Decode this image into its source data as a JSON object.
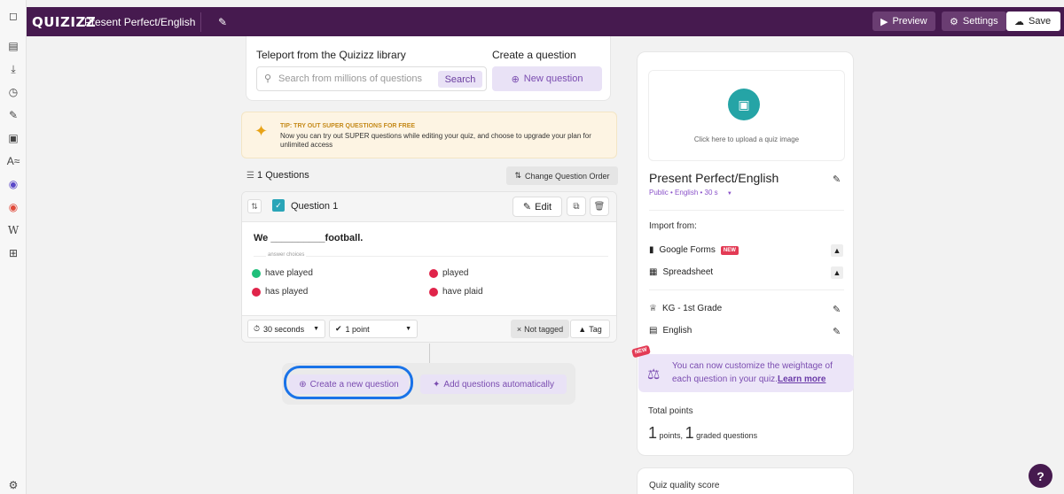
{
  "topbar": {
    "logo": "QUIZIZZ",
    "quiz_title": "Present Perfect/English",
    "preview_label": "Preview",
    "settings_label": "Settings",
    "save_label": "Save"
  },
  "teleport": {
    "heading": "Teleport from the Quizizz library",
    "search_placeholder": "Search from millions of questions",
    "search_button": "Search",
    "create_heading": "Create a question",
    "new_question_button": "New question"
  },
  "tip": {
    "title": "TIP: TRY OUT SUPER QUESTIONS FOR FREE",
    "body": "Now you can try out SUPER questions while editing your quiz, and choose to upgrade your plan for unlimited access"
  },
  "questions": {
    "count_label": "1 Questions",
    "change_order_label": "Change Question Order"
  },
  "question_card": {
    "label": "Question 1",
    "edit_label": "Edit",
    "text": "We __________football.",
    "answer_choices_label": "answer choices",
    "choices": [
      {
        "text": "have played",
        "correct": true
      },
      {
        "text": "played",
        "correct": false
      },
      {
        "text": "has played",
        "correct": false
      },
      {
        "text": "have plaid",
        "correct": false
      }
    ],
    "time_value": "30 seconds",
    "points_value": "1 point",
    "not_tagged_label": "Not tagged",
    "tag_label": "Tag"
  },
  "bottom_actions": {
    "create_new_label": "Create a new question",
    "add_auto_label": "Add questions automatically"
  },
  "right_panel": {
    "upload_text": "Click here to upload a quiz image",
    "title": "Present Perfect/English",
    "meta": "Public • English • 30 s",
    "import_from": "Import from:",
    "google_forms": "Google Forms",
    "new_badge": "NEW",
    "spreadsheet": "Spreadsheet",
    "grade": "KG - 1st Grade",
    "subject": "English"
  },
  "weightage": {
    "badge": "NEW",
    "text": "You can now customize the weightage of each question in your quiz.",
    "link": "Learn more"
  },
  "total_points": {
    "label": "Total points",
    "points_num": "1",
    "points_word": "points,",
    "graded_num": "1",
    "graded_word": "graded questions"
  },
  "quality": {
    "label": "Quiz quality score"
  },
  "colors": {
    "brand": "#461a4f",
    "accent_light": "#e9e2f6",
    "correct": "#1fbf7a",
    "incorrect": "#e0244a",
    "highlight": "#1a73e8"
  }
}
